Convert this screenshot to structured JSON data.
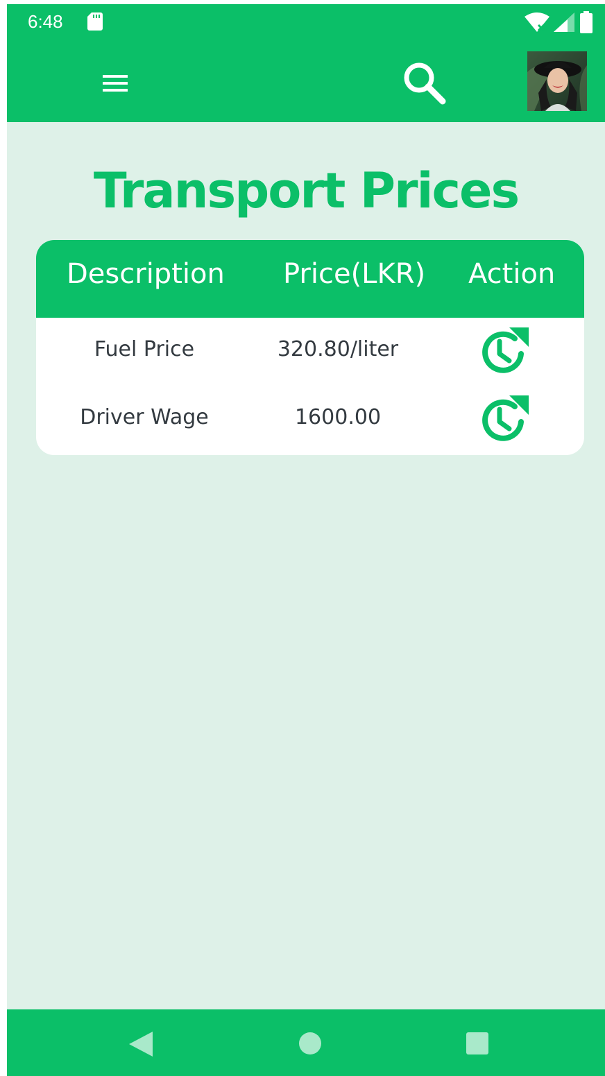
{
  "status_bar": {
    "time": "6:48",
    "icons": [
      "sd-card-icon",
      "wifi-icon",
      "signal-icon",
      "battery-icon"
    ]
  },
  "app_bar": {
    "menu_icon": "menu-icon",
    "search_icon": "search-icon",
    "avatar": "user-avatar"
  },
  "page": {
    "title": "Transport Prices"
  },
  "table": {
    "headers": {
      "description": "Description",
      "price": "Price(LKR)",
      "action": "Action"
    },
    "rows": [
      {
        "description": "Fuel Price",
        "price": "320.80/liter",
        "action_icon": "update-history-icon"
      },
      {
        "description": "Driver Wage",
        "price": "1600.00",
        "action_icon": "update-history-icon"
      }
    ]
  },
  "nav_bar": {
    "icons": [
      "back-icon",
      "home-icon",
      "recents-icon"
    ]
  },
  "colors": {
    "primary": "#0bbf68",
    "background": "#def1e8",
    "card": "#ffffff",
    "text_dark": "#333a40"
  }
}
